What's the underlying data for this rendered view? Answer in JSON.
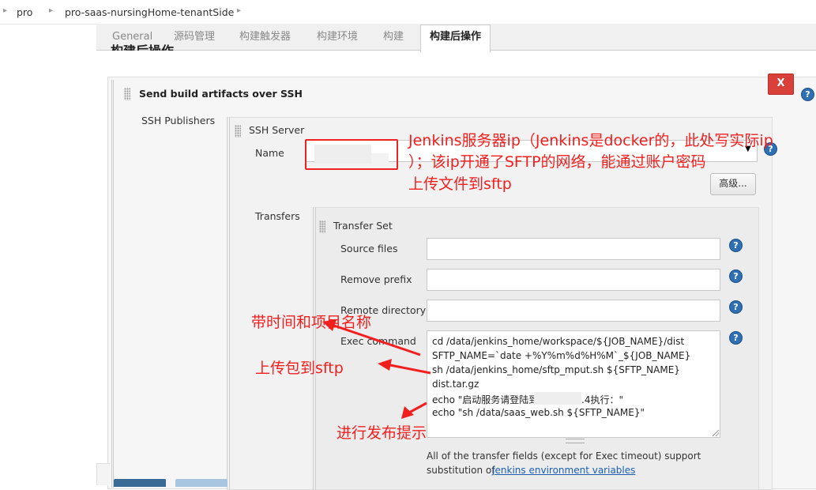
{
  "breadcrumb": {
    "items": [
      "pro",
      "pro-saas-nursingHome-tenantSide"
    ]
  },
  "tabs": [
    "General",
    "源码管理",
    "构建触发器",
    "构建环境",
    "构建",
    "构建后操作"
  ],
  "active_tab": "构建后操作",
  "section_heading": "构建后操作",
  "publisher": {
    "title": "Send build artifacts over SSH",
    "delete_label": "X",
    "ssh_publishers_label": "SSH Publishers",
    "ssh_server_label": "SSH Server",
    "name_label": "Name",
    "advanced_button": "高级...",
    "transfers_label": "Transfers",
    "transfer_set_label": "Transfer Set",
    "fields": [
      {
        "label": "Source files",
        "value": ""
      },
      {
        "label": "Remove prefix",
        "value": ""
      },
      {
        "label": "Remote directory",
        "value": ""
      }
    ],
    "exec_label": "Exec command",
    "exec_lines": [
      "cd  /data/jenkins_home/workspace/${JOB_NAME}/dist",
      "SFTP_NAME=`date +%Y%m%d%H%M`_${JOB_NAME}",
      "sh /data/jenkins_home/sftp_mput.sh ${SFTP_NAME}",
      "dist.tar.gz",
      "echo \"启动服务请登陆到",
      ".4执行：\"",
      "echo \"sh /data/saas_web.sh ${SFTP_NAME}\""
    ],
    "footer_text": "All of the transfer fields (except for Exec timeout) support",
    "footer_text2": "substitution of ",
    "footer_link": "Jenkins environment variables"
  },
  "annotations": {
    "ip_note_line1": "Jenkins服务器ip（Jenkins是docker的，此处写实际ip",
    "ip_note_line2": "）；该ip开通了SFTP的网络，能通过账户密码",
    "ip_note_line3": "上传文件到sftp",
    "note_time": "带时间和项目名称",
    "note_upload": "上传包到sftp",
    "note_publish": "进行发布提示"
  },
  "colors": {
    "annotation": "#f21f1f",
    "delete_button": "#d9403a",
    "help_icon": "#2f6fb3",
    "link": "#1a5fb4"
  }
}
